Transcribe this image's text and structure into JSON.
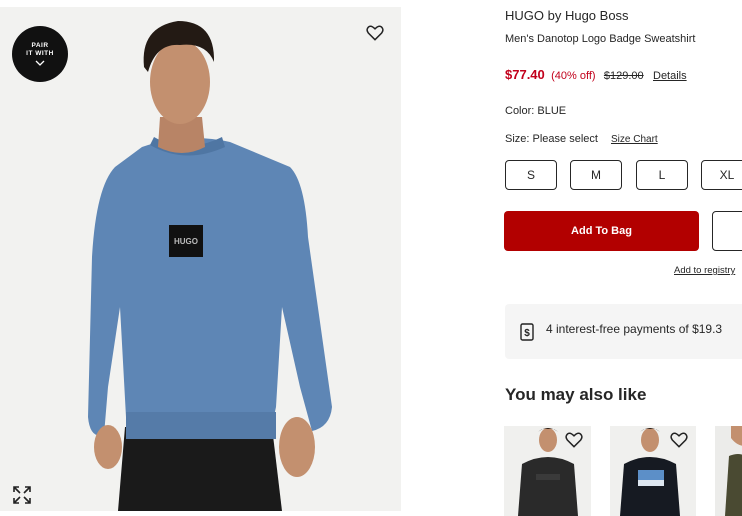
{
  "hero": {
    "pair_badge": {
      "line1": "PAIR",
      "line2": "IT WITH"
    },
    "shirt_logo_text": "HUGO"
  },
  "product": {
    "brand": "HUGO by Hugo Boss",
    "name": "Men's Danotop Logo Badge Sweatshirt",
    "price_current": "$77.40",
    "discount": "(40% off)",
    "price_original": "$129.00",
    "details_link": "Details",
    "color_label": "Color:",
    "color_value": "BLUE",
    "size_label": "Size: Please select",
    "size_chart_link": "Size Chart",
    "sizes": [
      "S",
      "M",
      "L",
      "XL"
    ],
    "add_to_bag": "Add To Bag",
    "add_to_registry": "Add to registry",
    "payments_text": "4 interest-free payments of $19.3"
  },
  "recommendations": {
    "title": "You may also like"
  },
  "colors": {
    "sale_red": "#c2001b",
    "bag_button": "#b20000",
    "sweatshirt_blue": "#5e86b5"
  },
  "icons": [
    "pair-chevron-icon",
    "heart-icon",
    "expand-icon",
    "dollar-tag-icon"
  ]
}
